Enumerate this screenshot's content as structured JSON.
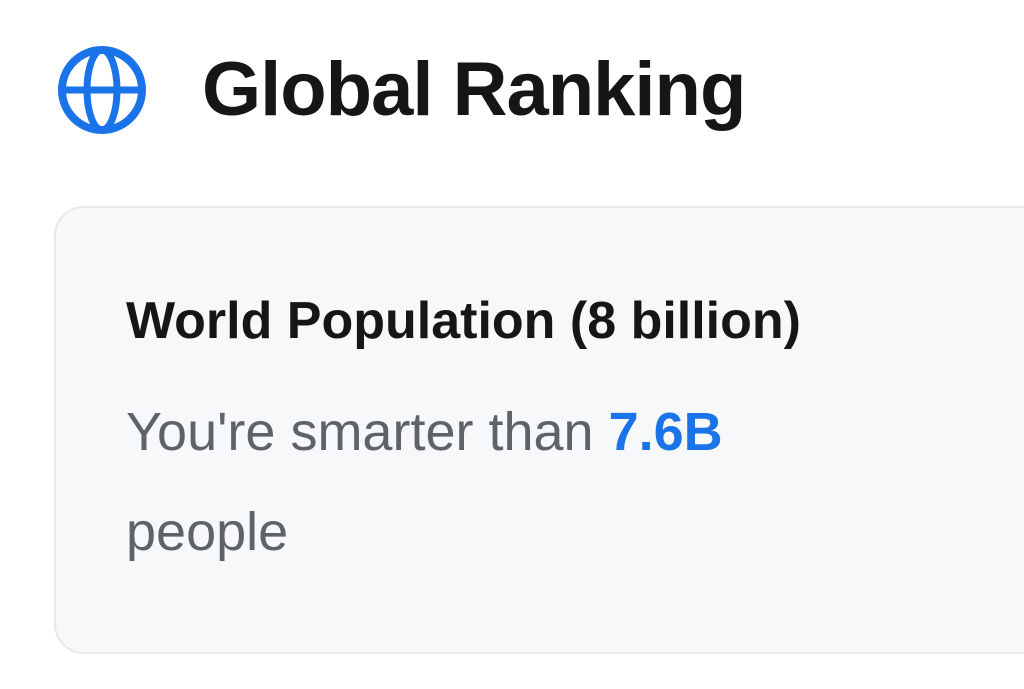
{
  "header": {
    "icon": "globe-icon",
    "title": "Global Ranking"
  },
  "ranking_card": {
    "title": "World Population (8 billion)",
    "text_prefix": "You're smarter than",
    "highlight_value": "7.6B",
    "text_suffix": "people"
  },
  "colors": {
    "accent": "#1a73e8",
    "title": "#161616",
    "muted_text": "#5f6268",
    "card_background": "#f6f8fa",
    "card_border": "#e5e8ec"
  }
}
